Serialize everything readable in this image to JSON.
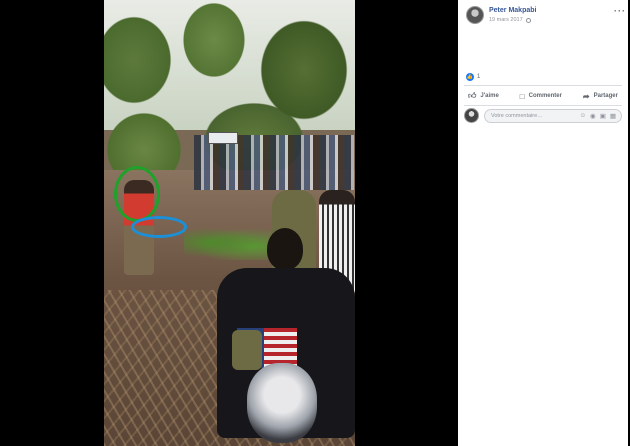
{
  "post": {
    "author": "Peter Makpabi",
    "date": "19 mars 2017",
    "privacy_icon": "globe-icon",
    "more_label": "···"
  },
  "reactions": {
    "icon": "like-icon",
    "count": "1"
  },
  "actions": {
    "like_label": "J'aime",
    "comment_label": "Commenter",
    "share_label": "Partager"
  },
  "comment_box": {
    "placeholder": "Votre commentaire…",
    "icons": [
      "emoji-icon",
      "camera-icon",
      "gif-icon",
      "sticker-icon"
    ]
  },
  "colors": {
    "author_link": "#385898",
    "like_blue": "#1877f2",
    "annotation_circle_green": "#1fa12a",
    "annotation_circle_blue": "#1b8fd8"
  }
}
